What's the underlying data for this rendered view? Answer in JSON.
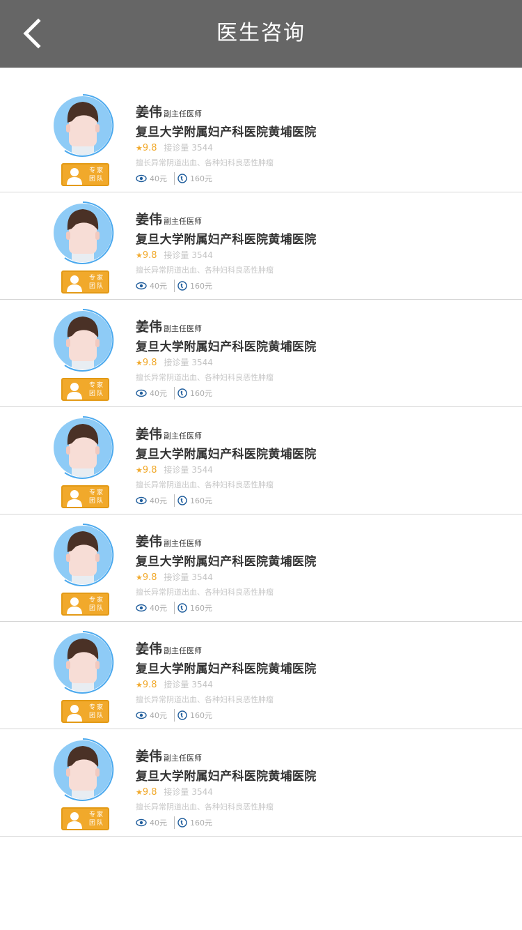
{
  "header": {
    "title": "医生咨询",
    "back_icon": "chevron-left-icon"
  },
  "colors": {
    "navbar": "#666666",
    "accent": "#f1a92b",
    "avatar_bg": "#8ecbf6",
    "avatar_ring": "#4ba9ee"
  },
  "badge": {
    "line1": "专家",
    "line2": "团队",
    "icon": "person-icon"
  },
  "doctors": [
    {
      "name": "姜伟",
      "title": "副主任医师",
      "hospital": "复旦大学附属妇产科医院黄埔医院",
      "score": "9.8",
      "consult_label": "接诊量",
      "consult_count": "3544",
      "specialty": "擅长异常阴道出血、各种妇科良恶性肿瘤",
      "text_price": "40元",
      "phone_price": "160元"
    },
    {
      "name": "姜伟",
      "title": "副主任医师",
      "hospital": "复旦大学附属妇产科医院黄埔医院",
      "score": "9.8",
      "consult_label": "接诊量",
      "consult_count": "3544",
      "specialty": "擅长异常阴道出血、各种妇科良恶性肿瘤",
      "text_price": "40元",
      "phone_price": "160元"
    },
    {
      "name": "姜伟",
      "title": "副主任医师",
      "hospital": "复旦大学附属妇产科医院黄埔医院",
      "score": "9.8",
      "consult_label": "接诊量",
      "consult_count": "3544",
      "specialty": "擅长异常阴道出血、各种妇科良恶性肿瘤",
      "text_price": "40元",
      "phone_price": "160元"
    },
    {
      "name": "姜伟",
      "title": "副主任医师",
      "hospital": "复旦大学附属妇产科医院黄埔医院",
      "score": "9.8",
      "consult_label": "接诊量",
      "consult_count": "3544",
      "specialty": "擅长异常阴道出血、各种妇科良恶性肿瘤",
      "text_price": "40元",
      "phone_price": "160元"
    },
    {
      "name": "姜伟",
      "title": "副主任医师",
      "hospital": "复旦大学附属妇产科医院黄埔医院",
      "score": "9.8",
      "consult_label": "接诊量",
      "consult_count": "3544",
      "specialty": "擅长异常阴道出血、各种妇科良恶性肿瘤",
      "text_price": "40元",
      "phone_price": "160元"
    },
    {
      "name": "姜伟",
      "title": "副主任医师",
      "hospital": "复旦大学附属妇产科医院黄埔医院",
      "score": "9.8",
      "consult_label": "接诊量",
      "consult_count": "3544",
      "specialty": "擅长异常阴道出血、各种妇科良恶性肿瘤",
      "text_price": "40元",
      "phone_price": "160元"
    },
    {
      "name": "姜伟",
      "title": "副主任医师",
      "hospital": "复旦大学附属妇产科医院黄埔医院",
      "score": "9.8",
      "consult_label": "接诊量",
      "consult_count": "3544",
      "specialty": "擅长异常阴道出血、各种妇科良恶性肿瘤",
      "text_price": "40元",
      "phone_price": "160元"
    }
  ]
}
